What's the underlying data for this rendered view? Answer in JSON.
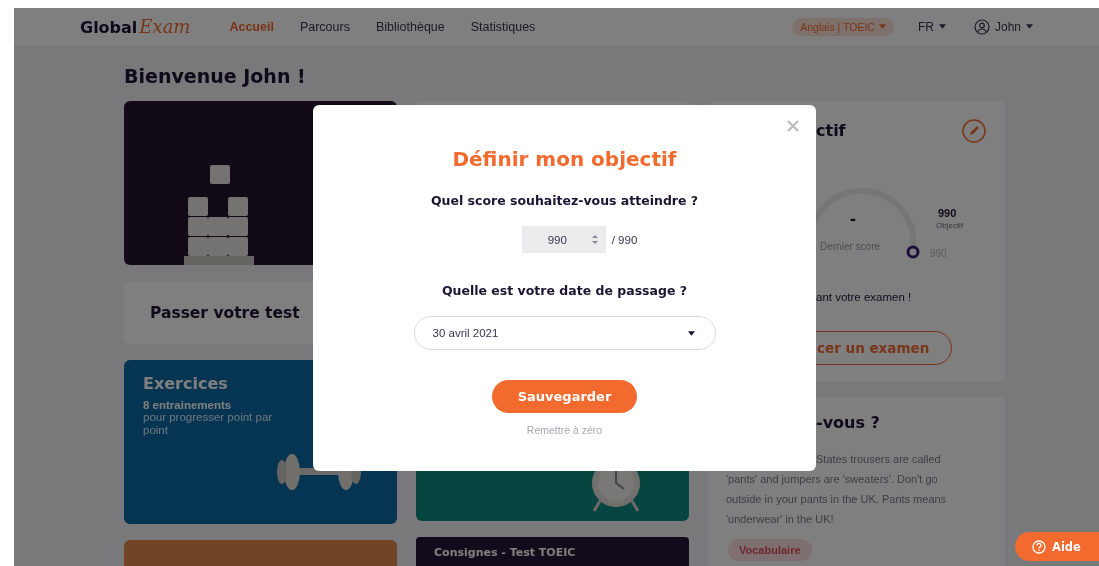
{
  "nav": {
    "logo": {
      "main": "Global",
      "accent": "Exam"
    },
    "links": [
      {
        "label": "Accueil",
        "selected": true
      },
      {
        "label": "Parcours",
        "selected": false
      },
      {
        "label": "Bibliothèque",
        "selected": false
      },
      {
        "label": "Statistiques",
        "selected": false
      }
    ],
    "course": "Anglais | TOEIC",
    "language": "FR",
    "user": "John"
  },
  "greeting": "Bienvenue John !",
  "test_card": {
    "title": "Passer votre test"
  },
  "exercises_card": {
    "title": "Exercices",
    "count": "8 entrainements",
    "description": "pour progresser point par point"
  },
  "instructions_card": {
    "title": "Consignes - Test TOEIC"
  },
  "objective_card": {
    "title": "ctif",
    "score": "-",
    "score_label": "Dernier score",
    "target": "990",
    "target_label": "Objectif",
    "scale_end": "990",
    "message": "ant votre examen !",
    "button": "cer un examen"
  },
  "tip_card": {
    "title": "-vous ?",
    "text": "States trousers are called 'pants' and jumpers are 'sweaters'. Don't go outside in your pants in the UK. Pants means 'underwear' in the UK!",
    "tag": "Vocabulaire"
  },
  "modal": {
    "title": "Définir mon objectif",
    "score_question": "Quel score souhaitez-vous atteindre ?",
    "score_value": "990",
    "score_max": "/ 990",
    "date_question": "Quelle est votre date de passage ?",
    "date_value": "30 avril 2021",
    "save_button": "Sauvegarder",
    "reset_link": "Remettre à zéro"
  },
  "help_button": "Aide"
}
